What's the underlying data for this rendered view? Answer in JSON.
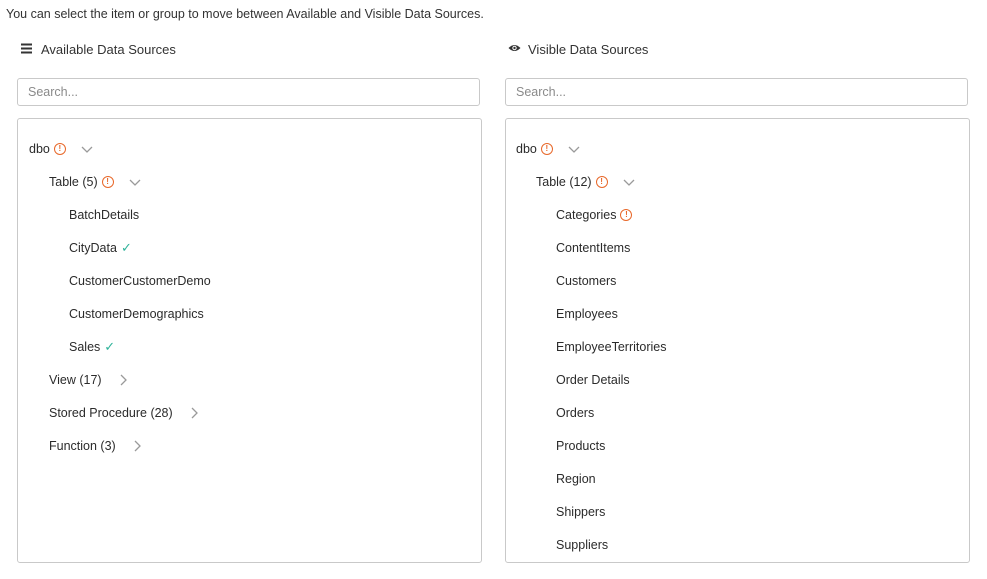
{
  "intro_text": "You can select the item or group to move between Available and Visible Data Sources.",
  "available": {
    "title": "Available Data Sources",
    "search_placeholder": "Search...",
    "schema_label": "dbo",
    "table_label": "Table (5)",
    "tables": [
      "BatchDetails",
      "CityData",
      "CustomerCustomerDemo",
      "CustomerDemographics",
      "Sales"
    ],
    "view_label": "View (17)",
    "stored_procedure_label": "Stored Procedure (28)",
    "function_label": "Function (3)"
  },
  "visible": {
    "title": "Visible Data Sources",
    "search_placeholder": "Search...",
    "schema_label": "dbo",
    "table_label": "Table (12)",
    "tables": [
      "Categories",
      "ContentItems",
      "Customers",
      "Employees",
      "EmployeeTerritories",
      "Order Details",
      "Orders",
      "Products",
      "Region",
      "Shippers",
      "Suppliers"
    ]
  },
  "colors": {
    "warning": "#e8682a",
    "check": "#2fb39a",
    "border": "#c9c9c9"
  }
}
